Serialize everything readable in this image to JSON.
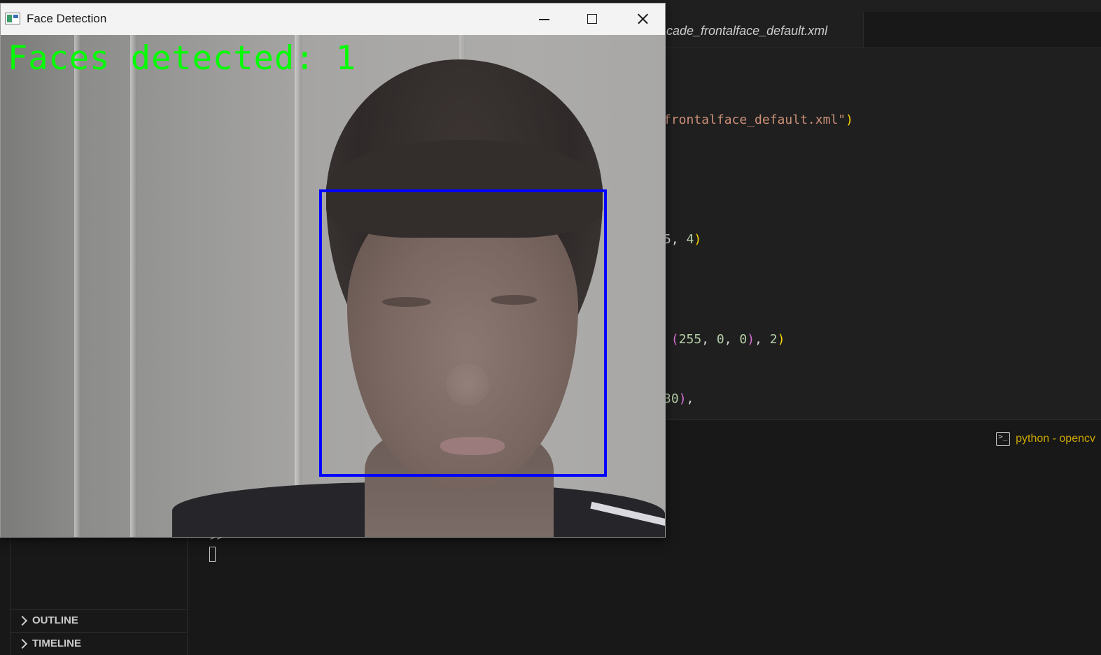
{
  "vscode": {
    "tab_label": "cade_frontalface_default.xml",
    "code_lines": [
      {
        "parts": [
          {
            "t": "frontalface_default.xml\"",
            "c": "s-str"
          },
          {
            "t": ")",
            "c": "s-brace"
          }
        ]
      },
      {
        "parts": [
          {
            "t": "5, ",
            "c": ""
          },
          {
            "t": "4",
            "c": "s-num"
          },
          {
            "t": ")",
            "c": "s-brace"
          }
        ]
      },
      {
        "parts": [
          {
            "t": " ",
            "c": ""
          },
          {
            "t": "(",
            "c": "s-brace2"
          },
          {
            "t": "255",
            "c": "s-num"
          },
          {
            "t": ", ",
            "c": ""
          },
          {
            "t": "0",
            "c": "s-num"
          },
          {
            "t": ", ",
            "c": ""
          },
          {
            "t": "0",
            "c": "s-num"
          },
          {
            "t": ")",
            "c": "s-brace2"
          },
          {
            "t": ", ",
            "c": ""
          },
          {
            "t": "2",
            "c": "s-num"
          },
          {
            "t": ")",
            "c": "s-brace"
          }
        ]
      },
      {
        "parts": [
          {
            "t": "30",
            "c": "s-num"
          },
          {
            "t": ")",
            "c": "s-brace2"
          },
          {
            "t": ",",
            "c": ""
          }
        ]
      }
    ],
    "terminal": {
      "tab_label": "python - opencv",
      "prompt": ">>"
    },
    "sidebar": {
      "outline_label": "OUTLINE",
      "timeline_label": "TIMELINE"
    }
  },
  "window": {
    "title": "Face Detection",
    "overlay_text": "Faces detected: 1",
    "overlay_color": "#00ff00",
    "box_color": "#0000ff",
    "faces_count": 1
  }
}
